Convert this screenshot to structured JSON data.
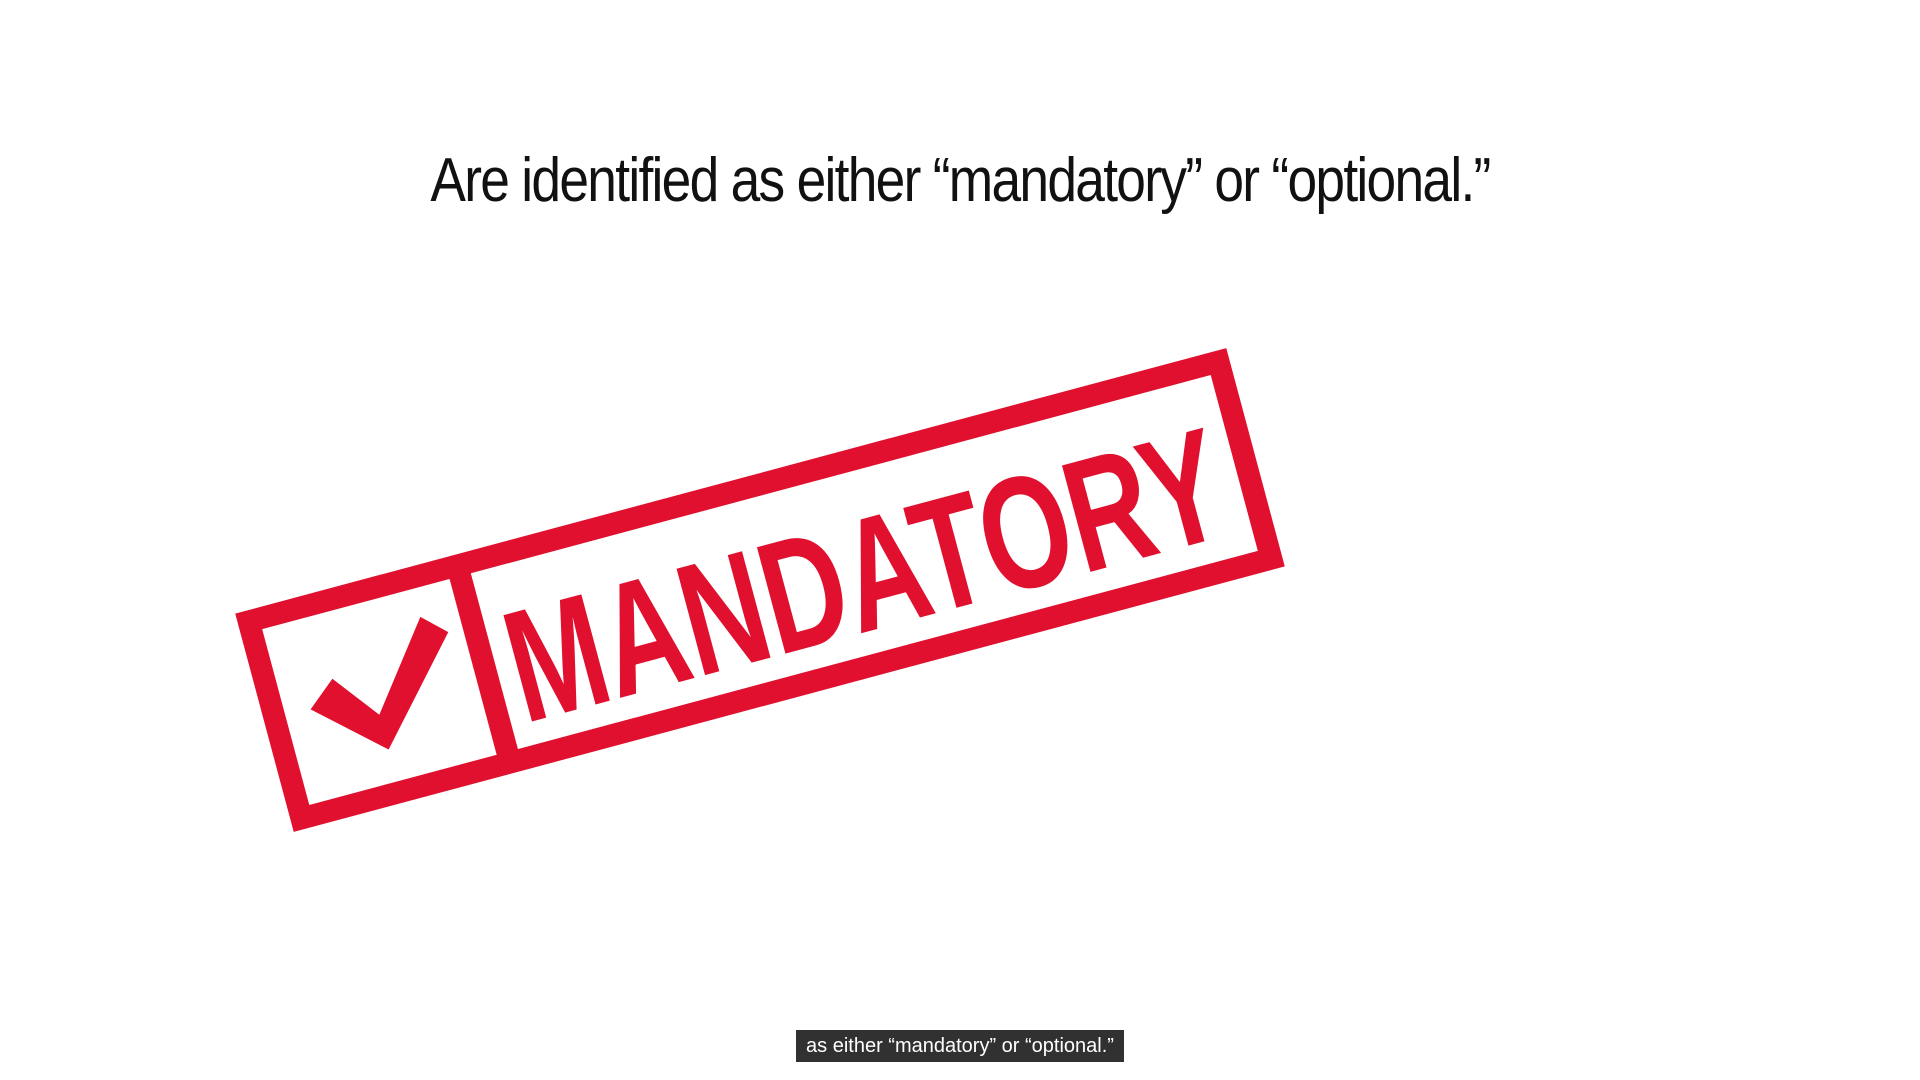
{
  "slide": {
    "headline": "Are identified as either “mandatory” or “optional.”"
  },
  "stamp": {
    "label": "MANDATORY",
    "icon": "checkmark-icon",
    "color": "#e0102e"
  },
  "subtitle": {
    "text": "as either “mandatory” or “optional.”"
  }
}
